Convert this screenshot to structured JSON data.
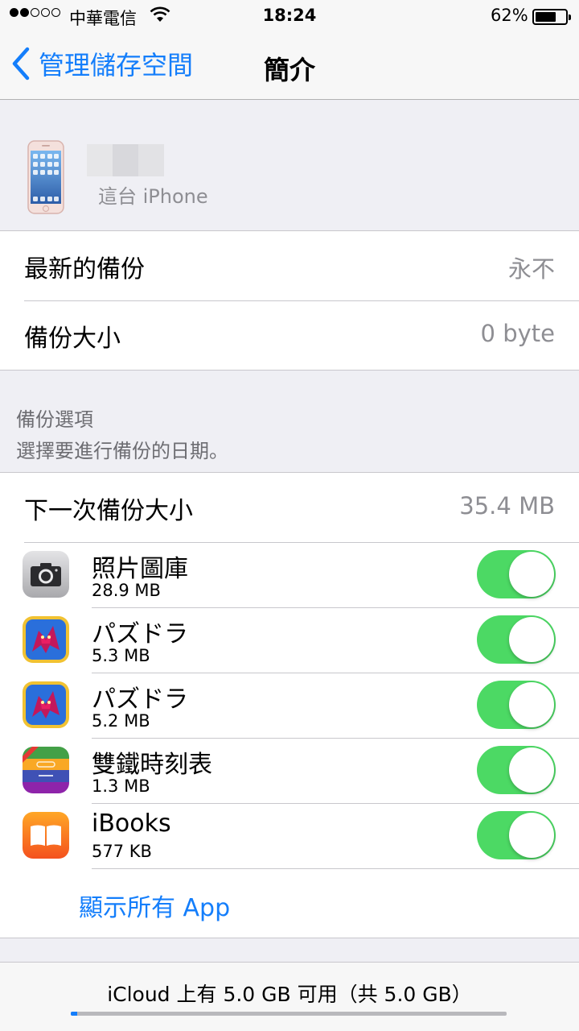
{
  "status_bar": {
    "carrier": "中華電信",
    "time": "18:24",
    "battery_percent_text": "62%",
    "battery_level": 0.62,
    "signal_bars_filled": 2,
    "signal_bars_total": 5
  },
  "nav": {
    "back_label": "管理儲存空間",
    "title": "簡介"
  },
  "device": {
    "subtitle": "這台 iPhone"
  },
  "backup_info": {
    "rows": [
      {
        "label": "最新的備份",
        "value": "永不"
      },
      {
        "label": "備份大小",
        "value": "0 byte"
      }
    ]
  },
  "backup_options": {
    "title": "備份選項",
    "description": "選擇要進行備份的日期。",
    "next_size_label": "下一次備份大小",
    "next_size_value": "35.4 MB",
    "apps": [
      {
        "name": "照片圖庫",
        "size": "28.9 MB",
        "enabled": true,
        "icon": "camera-icon"
      },
      {
        "name": "パズドラ",
        "size": "5.3 MB",
        "enabled": true,
        "icon": "puzzle-dragons-icon"
      },
      {
        "name": "パズドラ",
        "size": "5.2 MB",
        "enabled": true,
        "icon": "puzzle-dragons-icon"
      },
      {
        "name": "雙鐵時刻表",
        "size": "1.3 MB",
        "enabled": true,
        "icon": "train-timetable-icon"
      },
      {
        "name": "iBooks",
        "size": "577 KB",
        "enabled": true,
        "icon": "ibooks-icon"
      }
    ],
    "show_all_label": "顯示所有 App"
  },
  "footer": {
    "storage_text": "iCloud 上有 5.0 GB 可用（共 5.0 GB）",
    "used_fraction": 0.015
  },
  "colors": {
    "accent": "#147efb",
    "toggle_on": "#4cd964",
    "secondary_text": "#8e8e93",
    "background": "#efeff4"
  }
}
